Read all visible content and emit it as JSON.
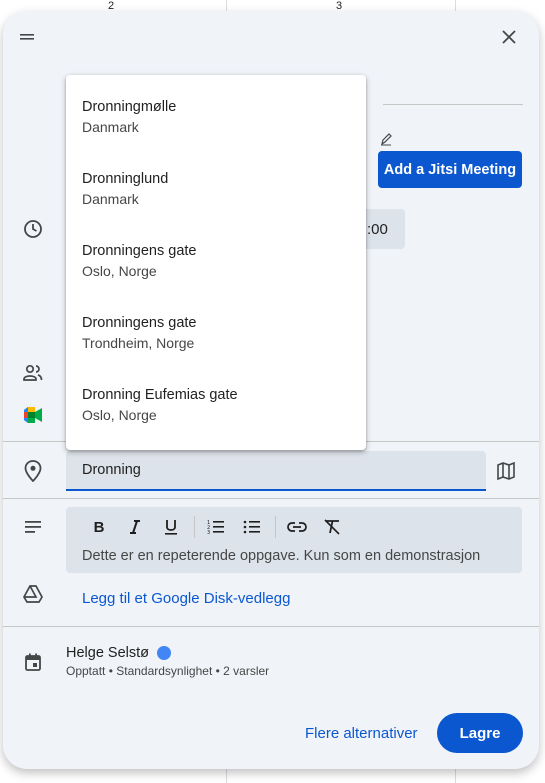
{
  "background": {
    "day_numbers": [
      "2",
      "3"
    ]
  },
  "dialog": {
    "close_icon": "close-icon",
    "drag_icon": "drag-handle-icon",
    "jitsi_button": "Add a Jitsi Meeting",
    "time_chip": ":00",
    "location_value": "Dronning",
    "description": "Dette er en repeterende oppgave. Kun som en demonstrasjon",
    "drive_link": "Legg til et Google Disk-vedlegg",
    "owner": {
      "name": "Helge Selstø",
      "details": "Opptatt • Standardsynlighet • 2 varsler",
      "color": "#4285f4"
    },
    "more_options": "Flere alternativer",
    "save": "Lagre"
  },
  "suggestions": [
    {
      "main": "Dronningmølle",
      "sub": "Danmark"
    },
    {
      "main": "Dronninglund",
      "sub": "Danmark"
    },
    {
      "main": "Dronningens gate",
      "sub": "Oslo, Norge"
    },
    {
      "main": "Dronningens gate",
      "sub": "Trondheim, Norge"
    },
    {
      "main": "Dronning Eufemias gate",
      "sub": "Oslo, Norge"
    }
  ],
  "colors": {
    "accent": "#0b57d0",
    "surface": "#f0f4f9",
    "field": "#dde3ea"
  }
}
